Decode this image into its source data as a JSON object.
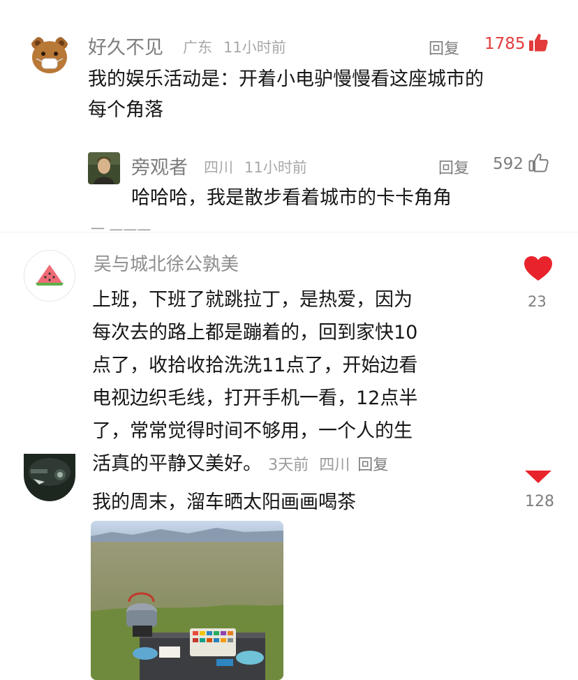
{
  "comment1": {
    "name": "好久不见",
    "location": "广东",
    "time": "11小时前",
    "reply_label": "回复",
    "like_count": "1785",
    "text_line1": "我的娱乐活动是：开着小电驴慢慢看这座城市的",
    "text_line2": "每个角落",
    "like_color": "#e33b3b"
  },
  "reply1": {
    "name": "旁观者",
    "location": "四川",
    "time": "11小时前",
    "reply_label": "回复",
    "like_count": "592",
    "text": "哈哈哈，我是散步看着城市的卡卡角角"
  },
  "comment2": {
    "name": "吴与城北徐公孰美",
    "text_lines": [
      "上班，下班了就跳拉丁，是热爱，因为",
      "每次去的路上都是蹦着的，回到家快10",
      "点了，收拾收拾洗洗11点了，开始边看",
      "电视边织毛线，打开手机一看，12点半",
      "了，常常觉得时间不够用，一个人的生",
      "活真的平静又美好。"
    ],
    "time": "3天前",
    "location": "四川",
    "reply_label": "回复",
    "like_count": "23",
    "like_color": "#e8232c"
  },
  "comment3": {
    "text": "我的周末，溜车晒太阳画画喝茶",
    "like_count": "128"
  }
}
